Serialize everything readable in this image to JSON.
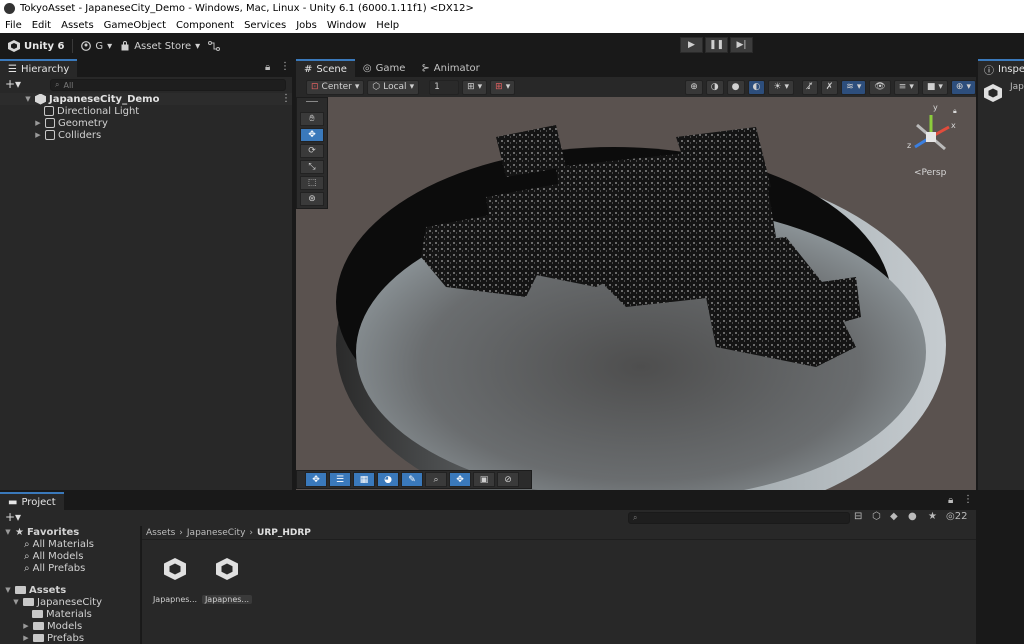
{
  "window": {
    "title": "TokyoAsset - JapaneseCity_Demo - Windows, Mac, Linux - Unity 6.1 (6000.1.11f1) <DX12>"
  },
  "menu": [
    "File",
    "Edit",
    "Assets",
    "GameObject",
    "Component",
    "Services",
    "Jobs",
    "Window",
    "Help"
  ],
  "toolbar": {
    "unity_label": "Unity 6",
    "account_label": "G",
    "asset_store_label": "Asset Store"
  },
  "hierarchy": {
    "tab_label": "Hierarchy",
    "search_placeholder": "All",
    "root": "JapaneseCity_Demo",
    "items": [
      "Directional Light",
      "Geometry",
      "Colliders"
    ]
  },
  "scene": {
    "tabs": [
      "Scene",
      "Game",
      "Animator"
    ],
    "pivot_label": "Center",
    "space_label": "Local",
    "snap_value": "1",
    "persp_label": "<Persp",
    "gizmo_axes": {
      "x": "x",
      "y": "y",
      "z": "z"
    }
  },
  "inspector": {
    "tab_label": "Inspec",
    "truncated_label": "Jap"
  },
  "project": {
    "tab_label": "Project",
    "hidden_count": "22",
    "favorites_label": "Favorites",
    "favorites": [
      "All Materials",
      "All Models",
      "All Prefabs"
    ],
    "assets_label": "Assets",
    "folders": [
      {
        "name": "JapaneseCity",
        "depth": 1
      },
      {
        "name": "Materials",
        "depth": 2
      },
      {
        "name": "Models",
        "depth": 2
      },
      {
        "name": "Prefabs",
        "depth": 2
      }
    ],
    "breadcrumb": [
      "Assets",
      "JapaneseCity",
      "URP_HDRP"
    ],
    "files": [
      {
        "name": "Japapnes...",
        "selected": false
      },
      {
        "name": "Japapnes...",
        "selected": true
      }
    ]
  },
  "colors": {
    "accent": "#3a79bb",
    "panel_bg": "#282828",
    "chrome_bg": "#191919"
  }
}
